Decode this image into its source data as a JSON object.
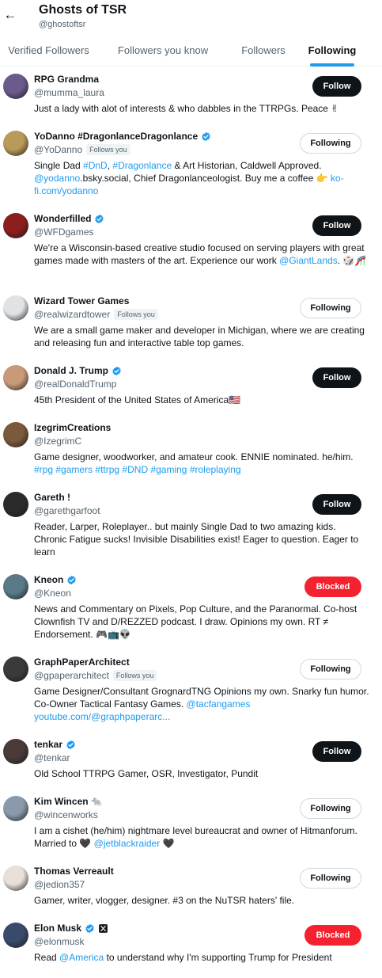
{
  "header": {
    "back_icon": "arrow-left-icon",
    "title": "Ghosts of TSR",
    "handle": "@ghostoftsr"
  },
  "tabs": [
    {
      "label": "Verified Followers",
      "active": false
    },
    {
      "label": "Followers you know",
      "active": false
    },
    {
      "label": "Followers",
      "active": false
    },
    {
      "label": "Following",
      "active": true
    }
  ],
  "follows_you_label": "Follows you",
  "users": [
    {
      "name": "RPG Grandma",
      "handle": "@mumma_laura",
      "verified": false,
      "follows_you": false,
      "button": "Follow",
      "bio": [
        "Just a lady with alot of interests & who dabbles in the TTRPGs. Peace ✌"
      ]
    },
    {
      "name": "YoDanno #DragonlanceDragonlance",
      "handle": "@YoDanno",
      "verified": true,
      "follows_you": true,
      "button": "Following",
      "bio": [
        "Single Dad ",
        {
          "link": "#DnD"
        },
        ", ",
        {
          "link": "#Dragonlance"
        },
        " & Art Historian, Caldwell Approved. ",
        {
          "link": "@yodanno"
        },
        ".bsky.social, Chief Dragonlanceologist. Buy me a coffee 👉 ",
        {
          "link": "ko-fi.com/yodanno"
        }
      ]
    },
    {
      "name": "Wonderfilled",
      "handle": "@WFDgames",
      "verified": true,
      "follows_you": false,
      "button": "Follow",
      "bio": [
        "We're a Wisconsin-based creative studio focused on serving players with great games made with masters of the art. Experience our work ",
        {
          "link": "@GiantLands"
        },
        ". 🎲🎢"
      ]
    },
    {
      "name": "Wizard Tower Games",
      "handle": "@realwizardtower",
      "verified": false,
      "follows_you": true,
      "button": "Following",
      "bio": [
        "We are a small game maker and developer in Michigan, where we are creating and releasing fun and interactive table top games."
      ]
    },
    {
      "name": "Donald J. Trump",
      "handle": "@realDonaldTrump",
      "verified": true,
      "follows_you": false,
      "button": "Follow",
      "bio": [
        "45th President of the United States of America🇺🇸"
      ]
    },
    {
      "name": "IzegrimCreations",
      "handle": "@IzegrimC",
      "verified": false,
      "follows_you": false,
      "button": "",
      "bio": [
        "Game designer, woodworker, and amateur cook. ENNIE nominated. he/him. ",
        {
          "link": "#rpg"
        },
        " ",
        {
          "link": "#gamers"
        },
        " ",
        {
          "link": "#ttrpg"
        },
        " ",
        {
          "link": "#DND"
        },
        " ",
        {
          "link": "#gaming"
        },
        " ",
        {
          "link": "#roleplaying"
        }
      ]
    },
    {
      "name": "Gareth !",
      "handle": "@garethgarfoot",
      "verified": false,
      "follows_you": false,
      "button": "Follow",
      "bio": [
        "Reader, Larper, Roleplayer.. but mainly Single Dad to two amazing kids. Chronic Fatigue sucks! Invisible Disabilities exist! Eager to question. Eager to learn"
      ]
    },
    {
      "name": "Kneon",
      "handle": "@Kneon",
      "verified": true,
      "follows_you": false,
      "button": "Blocked",
      "bio": [
        "News and Commentary on Pixels, Pop Culture, and the Paranormal. Co-host Clownfish TV and D/REZZED podcast. I draw. Opinions my own. RT ≠ Endorsement. 🎮📺👽"
      ]
    },
    {
      "name": "GraphPaperArchitect",
      "handle": "@gpaperarchitect",
      "verified": false,
      "follows_you": true,
      "button": "Following",
      "bio": [
        "Game Designer/Consultant GrognardTNG Opinions my own. Snarky fun humor. Co-Owner Tactical Fantasy Games. ",
        {
          "link": "@tacfangames"
        },
        " ",
        {
          "link": "youtube.com/@graphpaperarc..."
        }
      ]
    },
    {
      "name": "tenkar",
      "handle": "@tenkar",
      "verified": true,
      "follows_you": false,
      "button": "Follow",
      "bio": [
        "Old School TTRPG Gamer, OSR, Investigator, Pundit"
      ]
    },
    {
      "name": "Kim Wincen 🐀",
      "handle": "@wincenworks",
      "verified": false,
      "follows_you": false,
      "button": "Following",
      "bio": [
        "I am a cishet (he/him) nightmare level bureaucrat and owner of Hitmanforum. Married to 🖤 ",
        {
          "link": "@jetblackraider"
        },
        " 🖤"
      ]
    },
    {
      "name": "Thomas Verreault",
      "handle": "@jedion357",
      "verified": false,
      "follows_you": false,
      "button": "Following",
      "bio": [
        "Gamer, writer, vlogger, designer. #3 on the NuTSR haters' file."
      ]
    },
    {
      "name": "Elon Musk",
      "handle": "@elonmusk",
      "verified": true,
      "x_badge": true,
      "follows_you": false,
      "button": "Blocked",
      "bio": [
        "Read ",
        {
          "link": "@America"
        },
        " to understand why I'm supporting Trump for President"
      ]
    }
  ],
  "colors": {
    "accent": "#1d9bf0",
    "text": "#0f1419",
    "muted": "#536471",
    "blocked": "#f4212e"
  }
}
